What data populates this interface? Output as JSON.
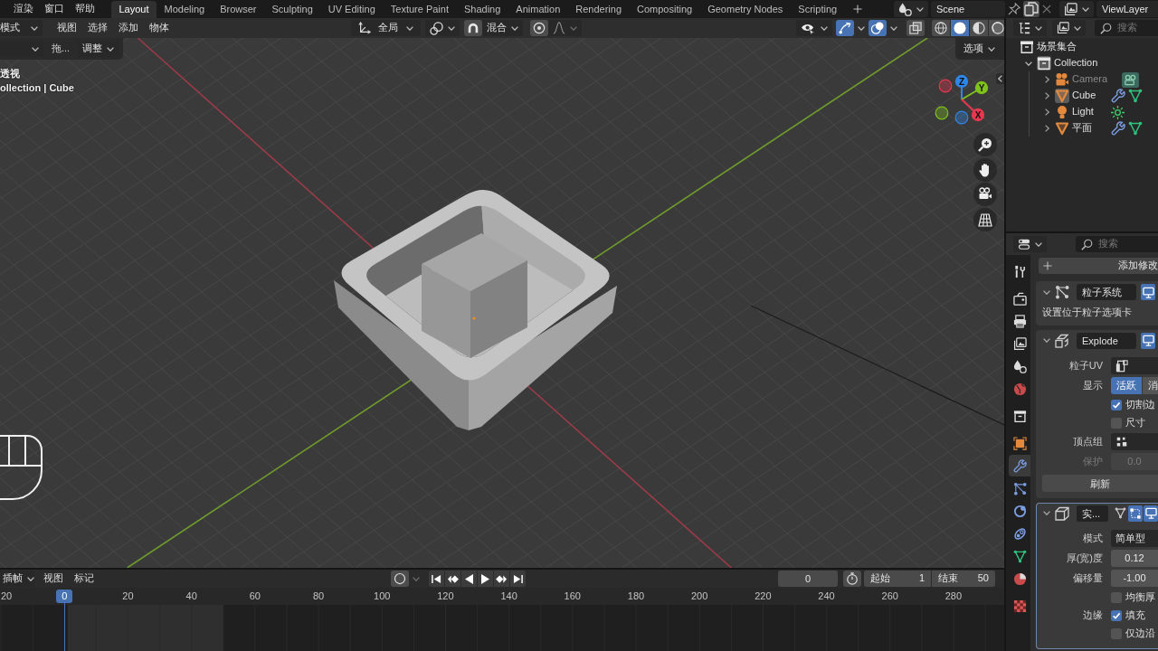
{
  "top_bar": {
    "menus": [
      "渲染",
      "窗口",
      "帮助"
    ],
    "workspaces": [
      {
        "label": "Layout",
        "selected": true
      },
      {
        "label": "Modeling",
        "selected": false
      },
      {
        "label": "Browser",
        "selected": false
      },
      {
        "label": "Sculpting",
        "selected": false
      },
      {
        "label": "UV Editing",
        "selected": false
      },
      {
        "label": "Texture Paint",
        "selected": false
      },
      {
        "label": "Shading",
        "selected": false
      },
      {
        "label": "Animation",
        "selected": false
      },
      {
        "label": "Rendering",
        "selected": false
      },
      {
        "label": "Compositing",
        "selected": false
      },
      {
        "label": "Geometry Nodes",
        "selected": false
      },
      {
        "label": "Scripting",
        "selected": false
      }
    ],
    "scene": "Scene",
    "view_layer": "ViewLayer"
  },
  "viewport": {
    "header": {
      "mode": "模式",
      "menus": [
        "视图",
        "选择",
        "添加",
        "物体"
      ],
      "orientation": "全局",
      "snap_on": false,
      "snap_target": "混合",
      "proportional_on": false,
      "gizmos_on": true,
      "overlays_on": true,
      "xray_on": false,
      "shading": [
        {
          "selected": false
        },
        {
          "selected": true
        },
        {
          "selected": false
        },
        {
          "selected": false
        }
      ]
    },
    "tool_settings": {
      "drag": "拖...",
      "adjust": "调整"
    },
    "options": "选项",
    "info": [
      "透视",
      "ollection | Cube"
    ],
    "gizmo_labels": [
      "Z",
      "Y",
      "X"
    ]
  },
  "timeline": {
    "keying": "插帧",
    "menus": [
      "视图",
      "标记"
    ],
    "current_frame": "0",
    "start_label": "起始",
    "start": "1",
    "end_label": "结束",
    "end": "50",
    "playhead": "0",
    "ruler": [
      "20",
      "20",
      "40",
      "60",
      "80",
      "100",
      "120",
      "140",
      "160",
      "180",
      "200",
      "220",
      "240",
      "260",
      "280"
    ]
  },
  "outliner": {
    "search_placeholder": "搜索",
    "tree": [
      {
        "kind": "scene_collection",
        "label": "场景集合",
        "selected": false,
        "children": [
          {
            "kind": "collection",
            "label": "Collection",
            "expanded": true,
            "selected": true,
            "children": [
              {
                "kind": "camera",
                "label": "Camera",
                "expanded": false,
                "selected": false,
                "disabled": true
              },
              {
                "kind": "mesh",
                "label": "Cube",
                "expanded": false,
                "selected": true,
                "disabled": false
              },
              {
                "kind": "light",
                "label": "Light",
                "expanded": false,
                "selected": false,
                "disabled": false
              },
              {
                "kind": "mesh",
                "label": "平面",
                "expanded": false,
                "selected": false,
                "disabled": false
              }
            ]
          }
        ]
      }
    ]
  },
  "properties": {
    "search_placeholder": "搜索",
    "tabs": [
      {
        "kind": "tool",
        "selected": false
      },
      {
        "kind": "render",
        "selected": false
      },
      {
        "kind": "output",
        "selected": false
      },
      {
        "kind": "view_layer",
        "selected": false
      },
      {
        "kind": "scene",
        "selected": false
      },
      {
        "kind": "world",
        "selected": false
      },
      {
        "kind": "collection",
        "selected": false
      },
      {
        "kind": "object",
        "selected": false
      },
      {
        "kind": "modifiers",
        "selected": true
      },
      {
        "kind": "particles",
        "selected": false
      },
      {
        "kind": "physics",
        "selected": false
      },
      {
        "kind": "constraints",
        "selected": false
      },
      {
        "kind": "data",
        "selected": false
      },
      {
        "kind": "material",
        "selected": false
      },
      {
        "kind": "texture",
        "selected": false
      }
    ],
    "add_modifier": "添加修改",
    "modifiers": [
      {
        "kind": "particle_system",
        "name": "粒子系统",
        "expanded": true,
        "active": false,
        "toggles": [
          {
            "kind": "viewport",
            "on": true
          }
        ],
        "note": "设置位于粒子选项卡"
      },
      {
        "kind": "explode",
        "name": "Explode",
        "expanded": true,
        "active": false,
        "toggles": [
          {
            "kind": "viewport",
            "on": true
          }
        ],
        "rows": [
          {
            "kind": "uv_map",
            "label": "粒子UV"
          },
          {
            "kind": "segmented",
            "label": "显示",
            "options": [
              {
                "label": "活跃",
                "selected": true
              },
              {
                "label": "消",
                "selected": false
              }
            ]
          },
          {
            "kind": "checkbox",
            "text": "切割边",
            "checked": true
          },
          {
            "kind": "checkbox",
            "text": "尺寸",
            "checked": false
          },
          {
            "kind": "vertex_group",
            "label": "顶点组"
          },
          {
            "kind": "number",
            "label": "保护",
            "value": "0.0",
            "disabled": true
          },
          {
            "kind": "button",
            "text": "刷新"
          }
        ]
      },
      {
        "kind": "solidify",
        "name": "实...",
        "expanded": true,
        "active": true,
        "toggles": [
          {
            "kind": "on_cage",
            "on": false
          },
          {
            "kind": "edit_mode",
            "on": true
          },
          {
            "kind": "viewport",
            "on": true
          }
        ],
        "rows": [
          {
            "kind": "dropdown",
            "label": "模式",
            "value": "简单型"
          },
          {
            "kind": "number",
            "label": "厚(宽)度",
            "value": "0.12",
            "disabled": false
          },
          {
            "kind": "number",
            "label": "偏移量",
            "value": "-1.00",
            "disabled": false
          },
          {
            "kind": "checkbox",
            "text": "均衡厚",
            "checked": false
          },
          {
            "kind": "checkbox",
            "label": "边缘",
            "text": "填充",
            "checked": true
          },
          {
            "kind": "checkbox",
            "text": "仅边沿",
            "checked": false
          }
        ]
      }
    ]
  }
}
